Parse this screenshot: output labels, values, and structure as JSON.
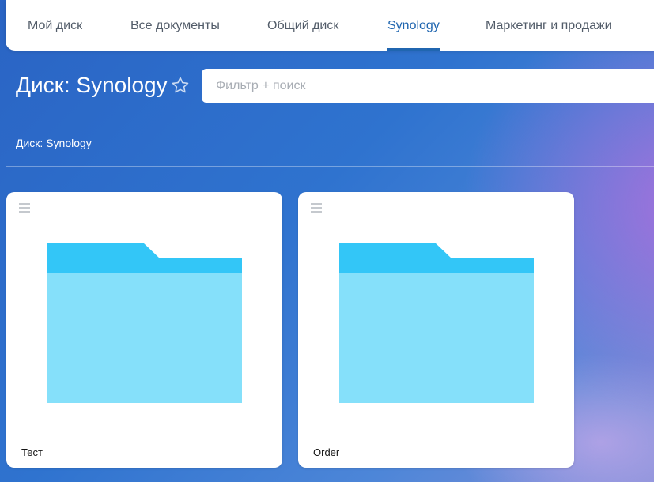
{
  "tabs": [
    {
      "label": "Мой диск",
      "active": false
    },
    {
      "label": "Все документы",
      "active": false
    },
    {
      "label": "Общий диск",
      "active": false
    },
    {
      "label": "Synology",
      "active": true
    },
    {
      "label": "Маркетинг и продажи",
      "active": false
    }
  ],
  "header": {
    "title": "Диск: Synology",
    "search_placeholder": "Фильтр + поиск"
  },
  "breadcrumb": {
    "label": "Диск: Synology"
  },
  "folders": [
    {
      "name": "Тест",
      "icon": "folder-icon"
    },
    {
      "name": "Order",
      "icon": "folder-icon"
    }
  ],
  "colors": {
    "accent": "#2066b0",
    "folder_tab": "#33c6f7",
    "folder_body": "#85e0fa"
  }
}
